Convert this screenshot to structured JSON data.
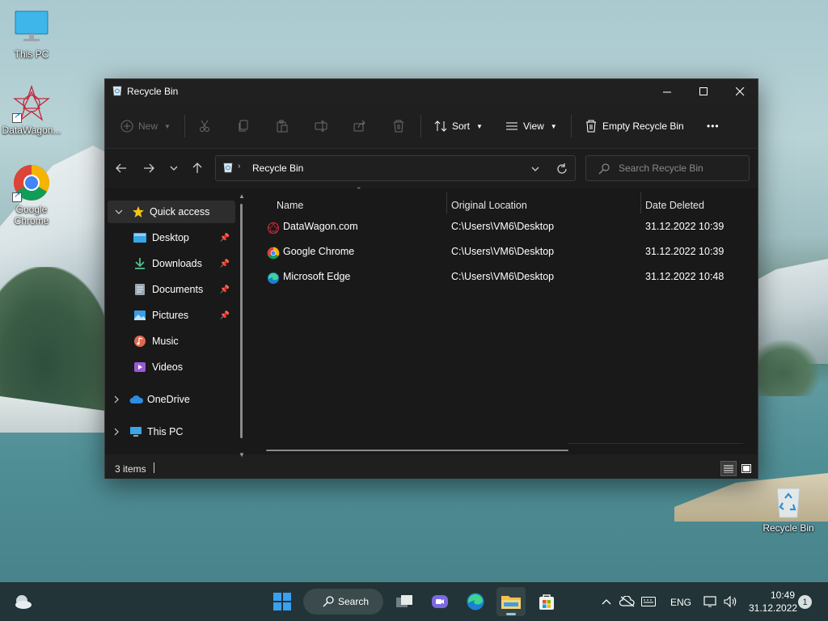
{
  "desktop": {
    "icons": [
      {
        "label": "This PC"
      },
      {
        "label": "DataWagon..."
      },
      {
        "label_line1": "Google",
        "label_line2": "Chrome"
      },
      {
        "label": "Recycle Bin"
      }
    ]
  },
  "window": {
    "title": "Recycle Bin",
    "toolbar": {
      "new_label": "New",
      "sort_label": "Sort",
      "view_label": "View",
      "empty_label": "Empty Recycle Bin",
      "more_label": "•••"
    },
    "address": {
      "path": "Recycle Bin",
      "search_placeholder": "Search Recycle Bin"
    },
    "sidebar": {
      "quick_access": "Quick access",
      "items": [
        {
          "label": "Desktop",
          "pinned": true
        },
        {
          "label": "Downloads",
          "pinned": true
        },
        {
          "label": "Documents",
          "pinned": true
        },
        {
          "label": "Pictures",
          "pinned": true
        },
        {
          "label": "Music",
          "pinned": false
        },
        {
          "label": "Videos",
          "pinned": false
        }
      ],
      "onedrive": "OneDrive",
      "thispc": "This PC"
    },
    "columns": {
      "name": "Name",
      "location": "Original Location",
      "date": "Date Deleted"
    },
    "files": [
      {
        "name": "DataWagon.com",
        "location": "C:\\Users\\VM6\\Desktop",
        "date": "31.12.2022 10:39"
      },
      {
        "name": "Google Chrome",
        "location": "C:\\Users\\VM6\\Desktop",
        "date": "31.12.2022 10:39"
      },
      {
        "name": "Microsoft Edge",
        "location": "C:\\Users\\VM6\\Desktop",
        "date": "31.12.2022 10:48"
      }
    ],
    "status": {
      "count": "3 items"
    }
  },
  "taskbar": {
    "search_label": "Search",
    "language": "ENG",
    "time": "10:49",
    "date": "31.12.2022",
    "notification_count": "1"
  }
}
